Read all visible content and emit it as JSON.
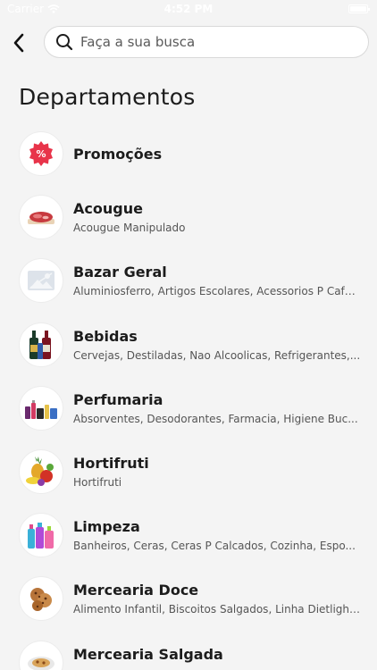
{
  "status_bar": {
    "carrier": "Carrier",
    "time": "4:52 PM"
  },
  "search": {
    "placeholder": "Faça a sua busca",
    "value": ""
  },
  "page_title": "Departamentos",
  "departments": [
    {
      "name": "Promoções",
      "subtitle": "",
      "icon": "percent-badge-icon"
    },
    {
      "name": "Acougue",
      "subtitle": "Acougue Manipulado",
      "icon": "meat-icon"
    },
    {
      "name": "Bazar Geral",
      "subtitle": "Aluminiosferro, Artigos Escolares, Acessorios P Cafe...",
      "icon": "image-placeholder-icon"
    },
    {
      "name": "Bebidas",
      "subtitle": "Cervejas, Destiladas, Nao Alcoolicas, Refrigerantes,...",
      "icon": "bottles-icon"
    },
    {
      "name": "Perfumaria",
      "subtitle": "Absorventes, Desodorantes, Farmacia, Higiene Buc...",
      "icon": "cosmetics-icon"
    },
    {
      "name": "Hortifruti",
      "subtitle": "Hortifruti",
      "icon": "fruits-icon"
    },
    {
      "name": "Limpeza",
      "subtitle": "Banheiros, Ceras, Ceras P Calcados, Cozinha, Espo...",
      "icon": "cleaning-products-icon"
    },
    {
      "name": "Mercearia Doce",
      "subtitle": "Alimento Infantil, Biscoitos Salgados, Linha Dietlight...",
      "icon": "cookies-icon"
    },
    {
      "name": "Mercearia Salgada",
      "subtitle": "",
      "icon": "plate-icon"
    }
  ]
}
